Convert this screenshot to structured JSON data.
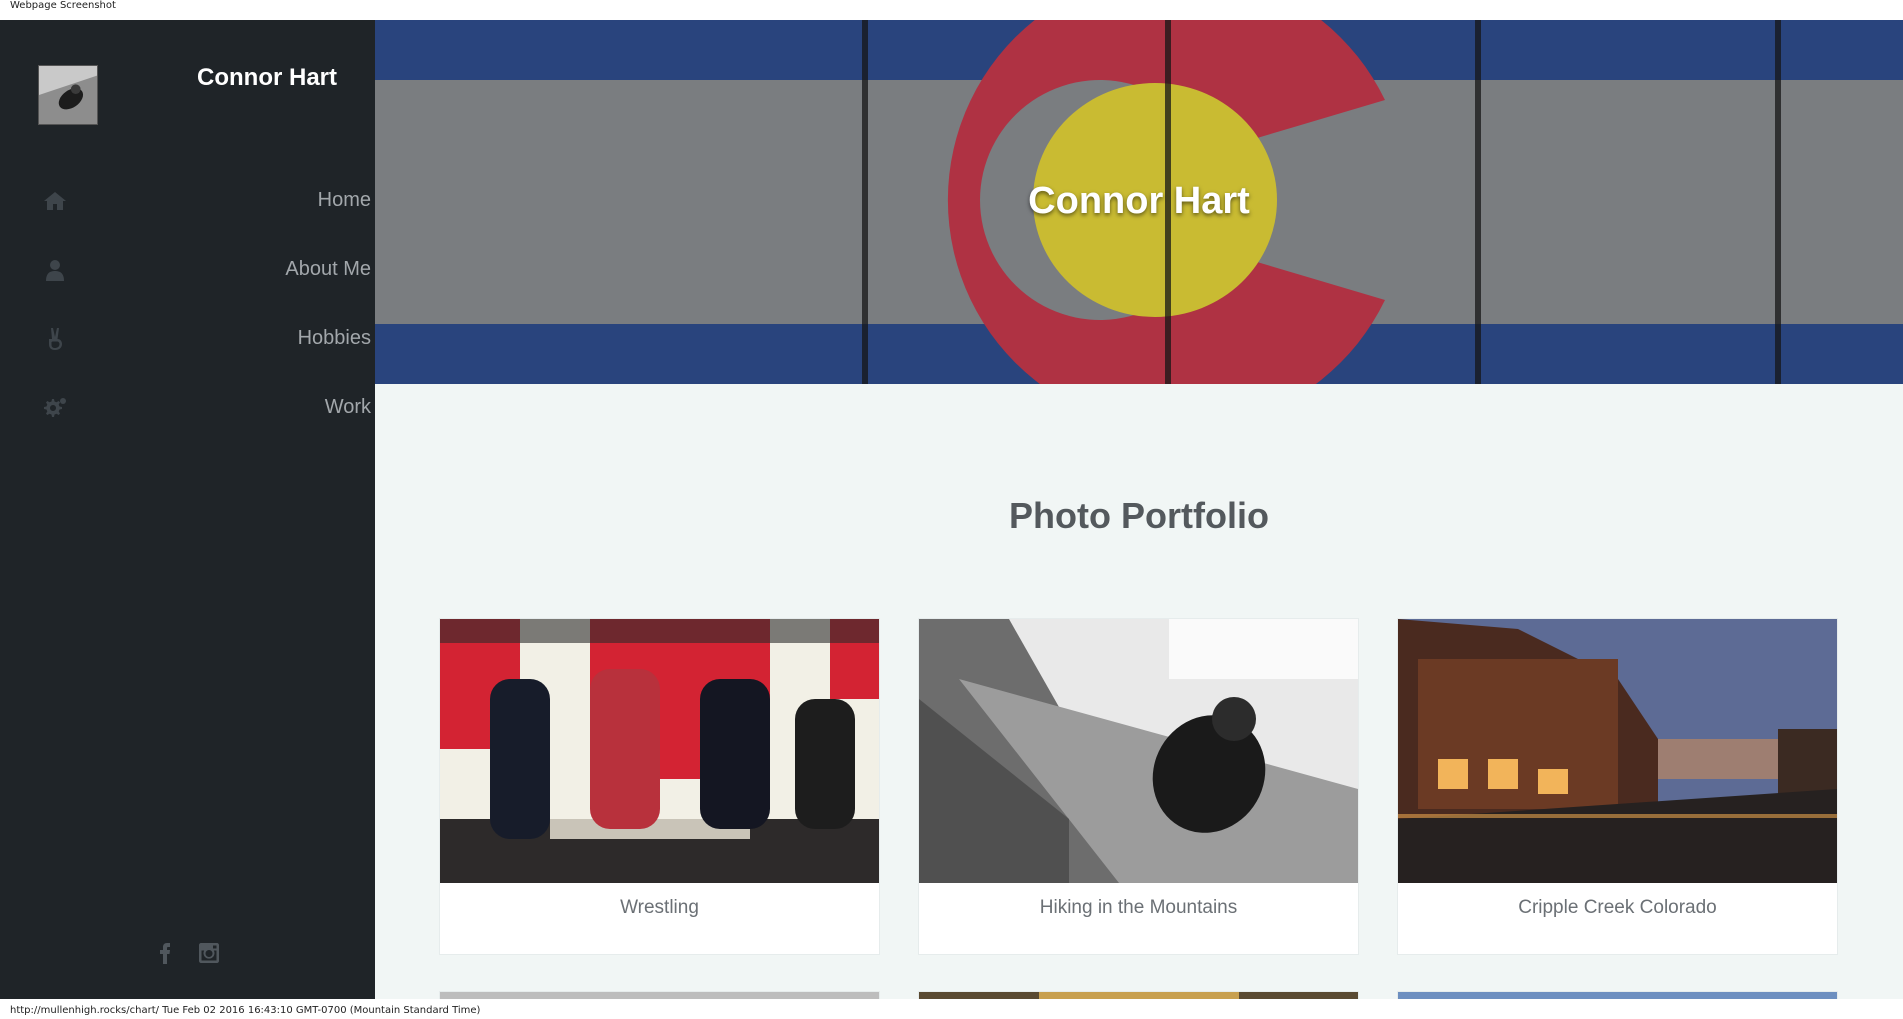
{
  "capture": {
    "header_text": "Webpage Screenshot",
    "footer_text": "http://mullenhigh.rocks/chart/ Tue Feb 02 2016 16:43:10 GMT-0700 (Mountain Standard Time)"
  },
  "sidebar": {
    "brand": "Connor Hart",
    "nav": [
      {
        "label": "Home",
        "icon": "home-icon"
      },
      {
        "label": "About Me",
        "icon": "user-icon"
      },
      {
        "label": "Hobbies",
        "icon": "peace-hand-icon"
      },
      {
        "label": "Work",
        "icon": "gears-icon"
      }
    ],
    "social": [
      {
        "icon": "facebook-icon"
      },
      {
        "icon": "instagram-icon"
      }
    ]
  },
  "hero": {
    "title": "Connor Hart"
  },
  "portfolio": {
    "title": "Photo Portfolio",
    "items": [
      {
        "caption": "Wrestling"
      },
      {
        "caption": "Hiking in the Mountains"
      },
      {
        "caption": "Cripple Creek Colorado"
      }
    ]
  },
  "colors": {
    "sidebar_bg": "#1f2428",
    "content_bg": "#f1f6f5",
    "flag_blue": "#2f4e8f",
    "flag_red": "#c8394d",
    "flag_yellow": "#e5d53a"
  }
}
